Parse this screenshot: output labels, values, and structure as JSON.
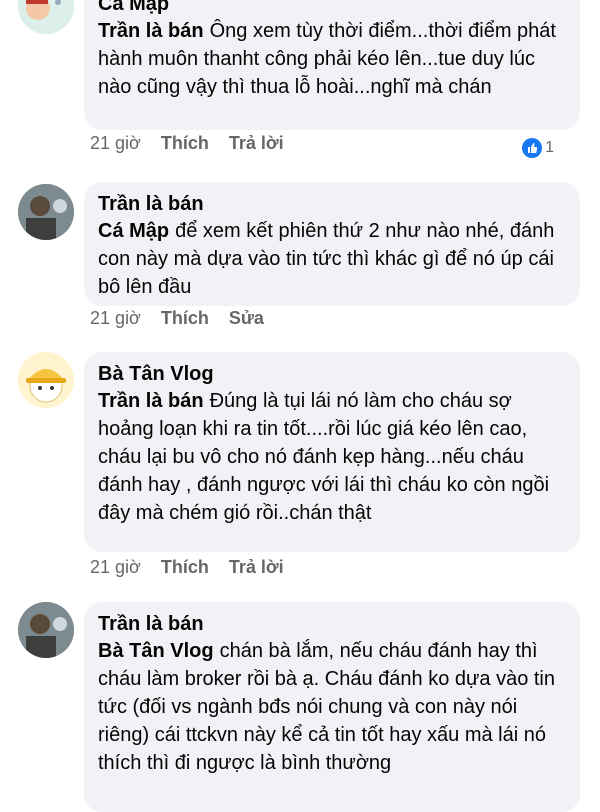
{
  "comments": [
    {
      "top_name": "Cá Mập",
      "author": "Trần là bán",
      "tag": "",
      "text": "Ông xem tùy thời điểm...thời điểm phát hành muôn thanht công phải kéo lên...tue duy lúc nào cũng vậy thì thua lỗ hoài...nghĩ mà chán",
      "time": "21 giờ",
      "action1": "Thích",
      "action2": "Trả lời",
      "likes": "1"
    },
    {
      "author": "Trần là bán",
      "tag": "Cá Mập",
      "text": "để xem kết phiên thứ 2 như nào nhé, đánh con này mà dựa vào tin tức thì khác gì để nó úp cái bô lên đầu",
      "time": "21 giờ",
      "action1": "Thích",
      "action2": "Sửa"
    },
    {
      "author": "Bà Tân Vlog",
      "tag": "Trần là bán",
      "text": "Đúng là tụi lái nó làm cho cháu sợ hoảng loạn khi ra tin tốt....rồi lúc giá kéo lên cao, cháu lại bu vô cho nó đánh kẹp hàng...nếu cháu đánh hay , đánh ngược với lái thì cháu ko còn ngồi đây mà chém gió rồi..chán thật",
      "time": "21 giờ",
      "action1": "Thích",
      "action2": "Trả lời"
    },
    {
      "author": "Trần là bán",
      "tag": "Bà Tân Vlog",
      "text": "chán bà lắm, nếu cháu đánh hay thì cháu làm broker rồi bà ạ. Cháu đánh ko dựa vào tin tức (đối vs ngành bđs nói chung và con này nói riêng) cái ttckvn này kể cả tin tốt hay xấu mà lái nó thích thì đi ngược là bình thường"
    }
  ],
  "icons": {
    "like": "thumbs-up-icon"
  },
  "colors": {
    "bubble": "#f0f2f5",
    "meta": "#65676b",
    "like": "#1877f2"
  }
}
